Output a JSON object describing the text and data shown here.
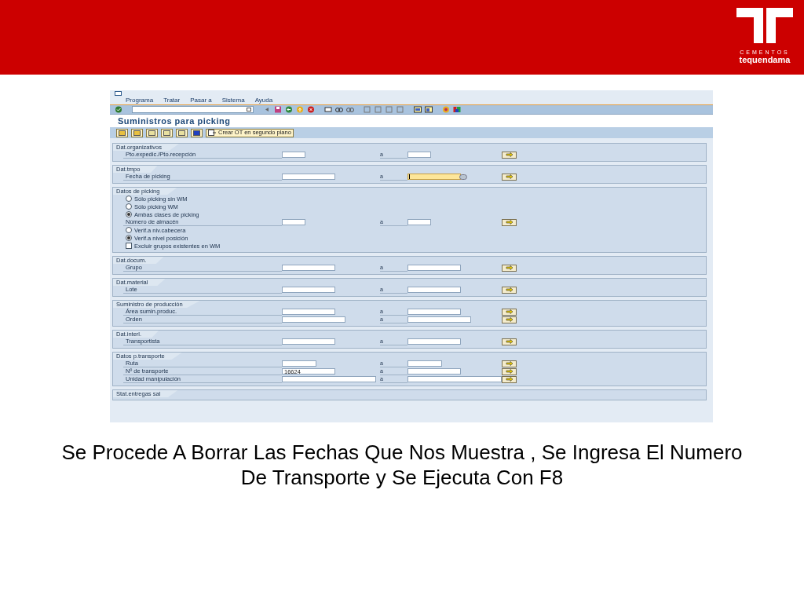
{
  "logo": {
    "line_1": "CEMENTOS",
    "line_2": "tequendama"
  },
  "sap": {
    "menu": [
      {
        "label": "Programa"
      },
      {
        "label": "Tratar"
      },
      {
        "label": "Pasar a"
      },
      {
        "label": "Sistema"
      },
      {
        "label": "Ayuda"
      }
    ],
    "title": "Suministros para picking",
    "app_button": "Crear OT en segundo plano",
    "groups": [
      {
        "title": "Dat.organizativos",
        "rows": [
          {
            "kind": "range",
            "label": "Pto.expedic./Pto.recepción",
            "to_label": "a"
          }
        ]
      },
      {
        "title": "Dat.tmpo",
        "rows": [
          {
            "kind": "range",
            "label": "Fecha de picking",
            "to_label": "a",
            "to_focused": true
          }
        ]
      },
      {
        "title": "Datos de picking",
        "rows": [
          {
            "kind": "radio",
            "label": "Sólo picking sin WM",
            "selected": false
          },
          {
            "kind": "radio",
            "label": "Sólo picking WM",
            "selected": false
          },
          {
            "kind": "radio",
            "label": "Ambas clases de picking",
            "selected": true
          },
          {
            "kind": "range",
            "label": "Número de almacén",
            "to_label": "a"
          },
          {
            "kind": "radio",
            "label": "Verif.a niv.cabecera",
            "selected": false
          },
          {
            "kind": "radio",
            "label": "Verif.a nivel posición",
            "selected": true
          },
          {
            "kind": "checkbox",
            "label": "Excluir grupos existentes en WM",
            "checked": false
          }
        ]
      },
      {
        "title": "Dat.docum.",
        "rows": [
          {
            "kind": "range",
            "label": "Grupo",
            "to_label": "a"
          }
        ]
      },
      {
        "title": "Dat.material",
        "rows": [
          {
            "kind": "range",
            "label": "Lote",
            "to_label": "a"
          }
        ]
      },
      {
        "title": "Suministro de producción",
        "rows": [
          {
            "kind": "range",
            "label": "Área sumin.produc.",
            "to_label": "a"
          },
          {
            "kind": "range",
            "label": "Orden",
            "to_label": "a"
          }
        ]
      },
      {
        "title": "Dat.interl.",
        "rows": [
          {
            "kind": "range",
            "label": "Transportista",
            "to_label": "a"
          }
        ]
      },
      {
        "title": "Datos p.transporte",
        "rows": [
          {
            "kind": "range",
            "label": "Ruta",
            "to_label": "a"
          },
          {
            "kind": "range",
            "label": "Nº de transporte",
            "to_label": "a",
            "from_value": "16624"
          },
          {
            "kind": "range",
            "label": "Unidad manipulación",
            "to_label": "a"
          }
        ]
      },
      {
        "title": "Stat.entregas sal"
      }
    ]
  },
  "caption": "Se Procede A Borrar Las Fechas Que Nos Muestra , Se Ingresa  El Numero De Transporte  y Se Ejecuta Con  F8"
}
